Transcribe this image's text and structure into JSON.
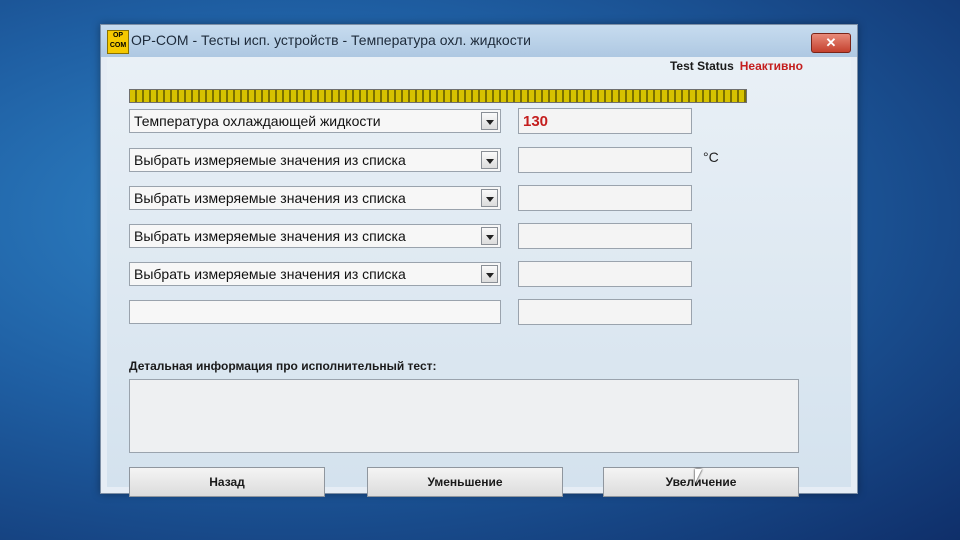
{
  "window": {
    "title": "OP-COM - Тесты исп. устройств - Температура охл. жидкости",
    "app_icon_text": "OP COM",
    "close_label": "✕"
  },
  "status": {
    "label": "Test Status",
    "value": "Неактивно"
  },
  "progress": {
    "fraction": 1.0
  },
  "rows": [
    {
      "combo": "Температура охлаждающей жидкости",
      "value": "130",
      "has_dropdown": true
    },
    {
      "combo": "Выбрать измеряемые значения из списка",
      "value": "",
      "has_dropdown": true
    },
    {
      "combo": "Выбрать измеряемые значения из списка",
      "value": "",
      "has_dropdown": true
    },
    {
      "combo": "Выбрать измеряемые значения из списка",
      "value": "",
      "has_dropdown": true
    },
    {
      "combo": "Выбрать измеряемые значения из списка",
      "value": "",
      "has_dropdown": true
    },
    {
      "combo": "",
      "value": "",
      "has_dropdown": false
    }
  ],
  "unit": "°C",
  "detail": {
    "label": "Детальная информация про исполнительный тест:",
    "text": ""
  },
  "buttons": {
    "back": "Назад",
    "decrease": "Уменьшение",
    "increase": "Увеличение"
  },
  "colors": {
    "status_value": "#c41e1e",
    "progress": "#d6c200",
    "value_text": "#c41e1e"
  }
}
